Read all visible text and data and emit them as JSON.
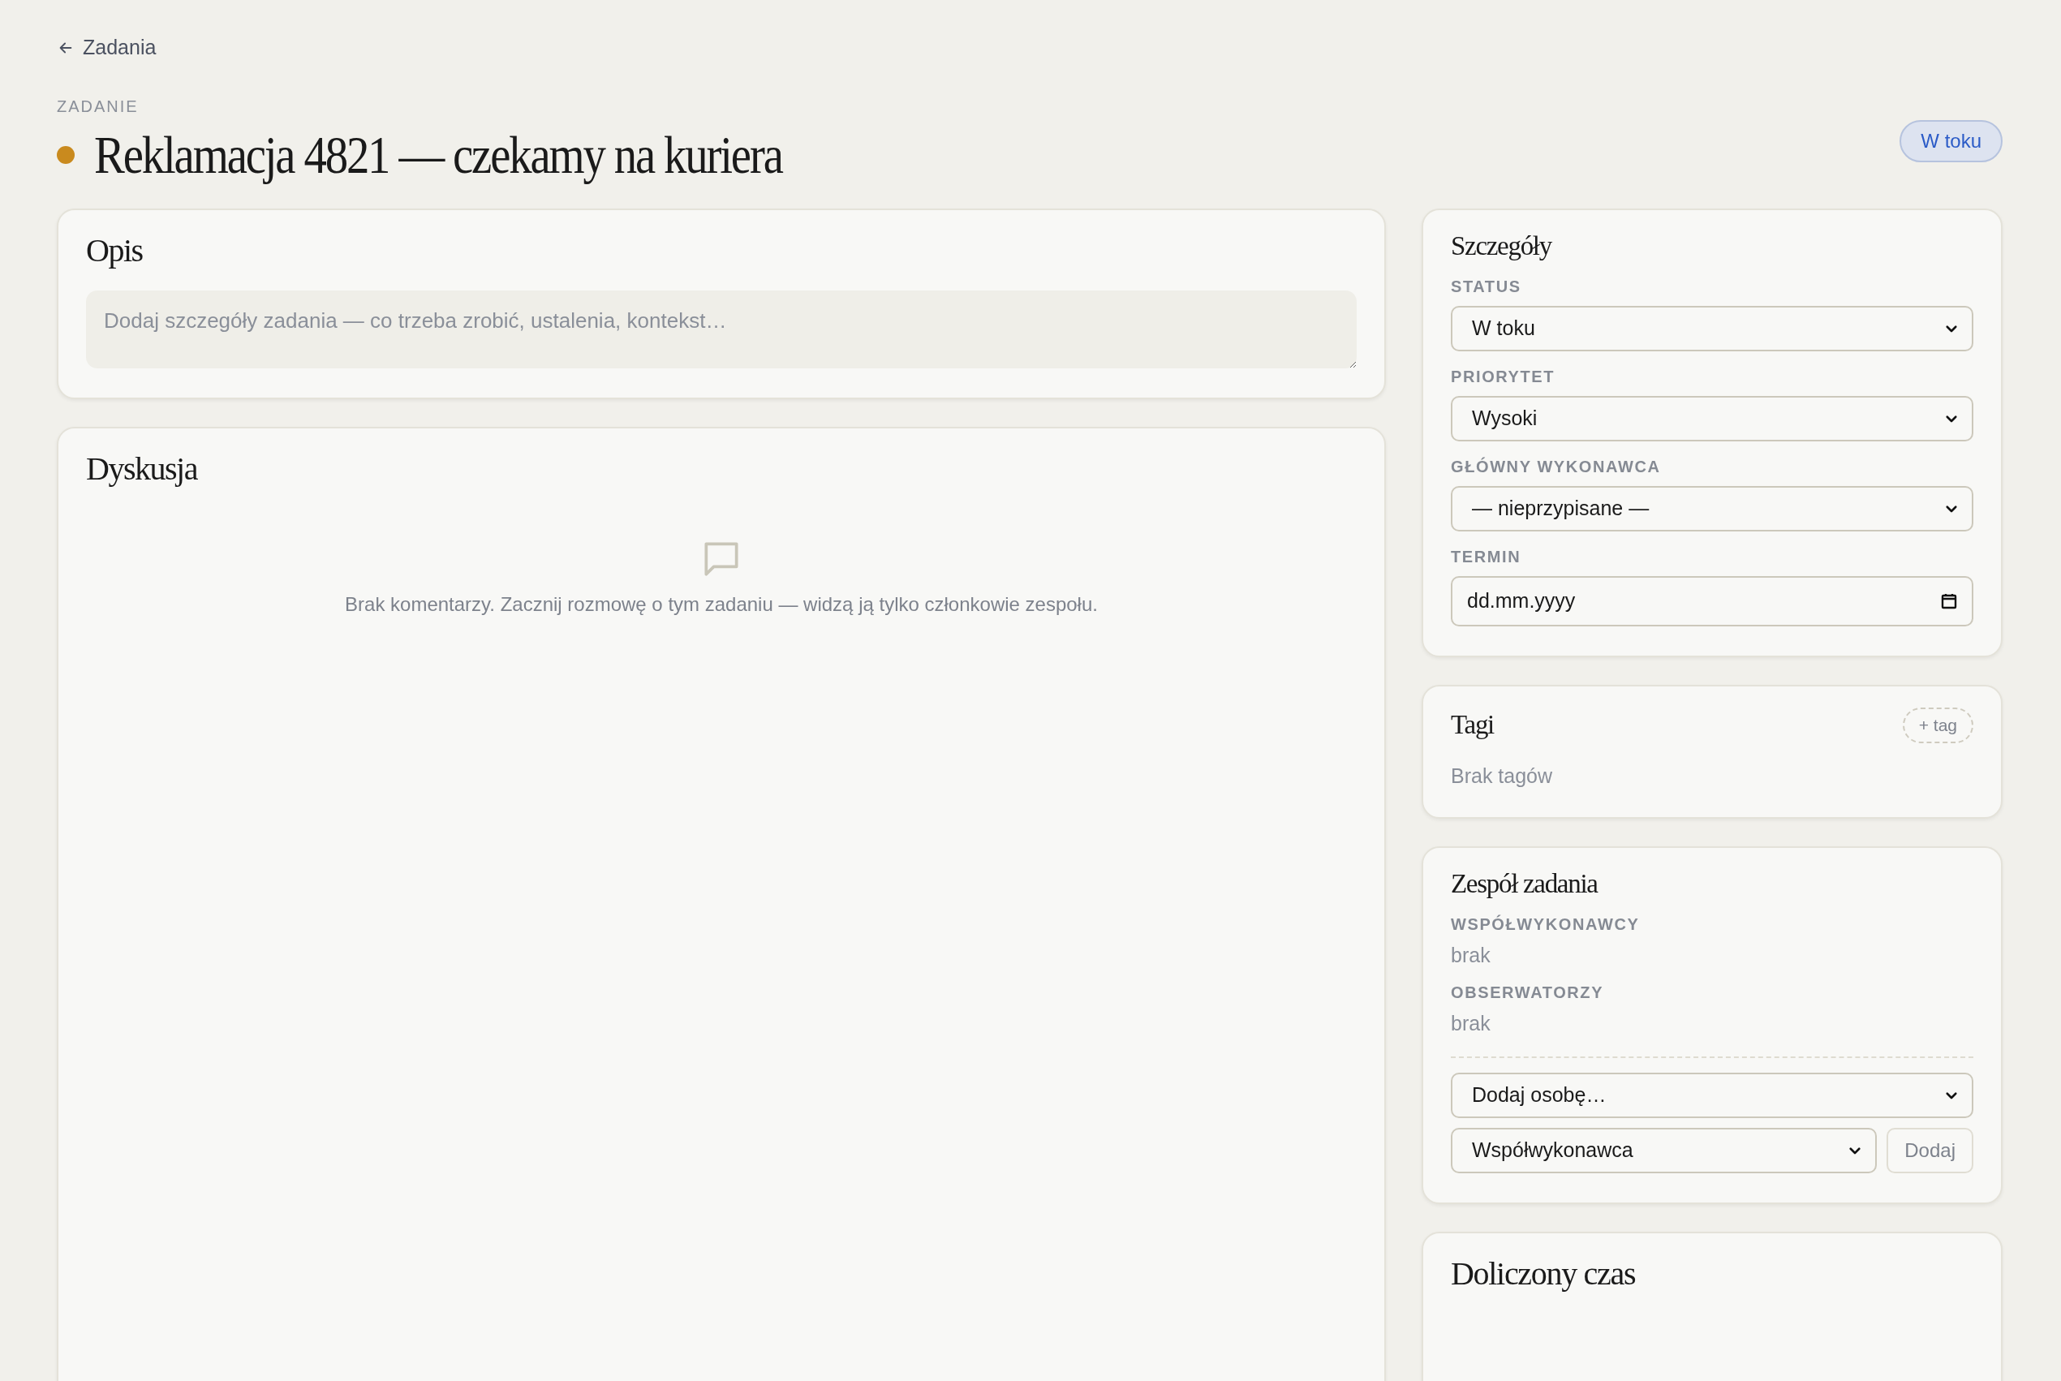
{
  "back_link": {
    "label": "Zadania"
  },
  "header": {
    "eyebrow": "ZADANIE",
    "title": "Reklamacja 4821 — czekamy na kuriera",
    "color": "#c98a1e",
    "status_badge": "W toku"
  },
  "description": {
    "title": "Opis",
    "placeholder": "Dodaj szczegóły zadania — co trzeba zrobić, ustalenia, kontekst…"
  },
  "discussion": {
    "title": "Dyskusja",
    "empty_text": "Brak komentarzy. Zacznij rozmowę o tym zadaniu — widzą ją tylko członkowie zespołu."
  },
  "details": {
    "title": "Szczegóły",
    "fields": [
      {
        "label": "STATUS",
        "kind": "select",
        "value": "W toku"
      },
      {
        "label": "PRIORYTET",
        "kind": "select",
        "value": "Wysoki"
      },
      {
        "label": "GŁÓWNY WYKONAWCA",
        "kind": "select",
        "value": "— nieprzypisane —"
      },
      {
        "label": "TERMIN",
        "kind": "date",
        "value": "dd.mm.yyyy"
      }
    ]
  },
  "tags": {
    "title": "Tagi",
    "add_button": "+ tag",
    "empty_text": "Brak tagów"
  },
  "team": {
    "title": "Zespół zadania",
    "sections": [
      {
        "label": "WSPÓŁWYKONAWCY",
        "value": "brak"
      },
      {
        "label": "OBSERWATORZY",
        "value": "brak"
      }
    ],
    "person_select": "Dodaj osobę…",
    "role_select": "Współwykonawca",
    "add_button": "Dodaj"
  },
  "time": {
    "title": "Doliczony czas"
  }
}
